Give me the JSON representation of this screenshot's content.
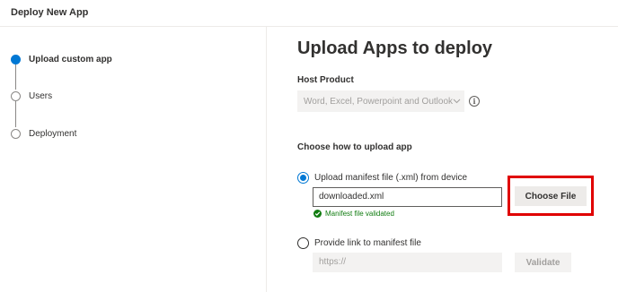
{
  "header": {
    "title": "Deploy New App"
  },
  "wizard": {
    "steps": [
      {
        "label": "Upload custom app",
        "active": true
      },
      {
        "label": "Users",
        "active": false
      },
      {
        "label": "Deployment",
        "active": false
      }
    ]
  },
  "main": {
    "title": "Upload Apps to deploy",
    "host_product": {
      "label": "Host Product",
      "value": "Word, Excel, Powerpoint and Outlook",
      "info_icon": "info-icon"
    },
    "upload_section": {
      "label": "Choose how to upload app",
      "option_file": {
        "label": "Upload manifest file (.xml) from device",
        "selected": true,
        "file_name": "downloaded.xml",
        "choose_button": "Choose File",
        "validation_message": "Manifest file validated"
      },
      "option_link": {
        "label": "Provide link to manifest file",
        "selected": false,
        "placeholder": "https://",
        "validate_button": "Validate"
      }
    }
  },
  "colors": {
    "accent": "#0078d4",
    "success": "#107c10",
    "highlight": "#e00000"
  }
}
